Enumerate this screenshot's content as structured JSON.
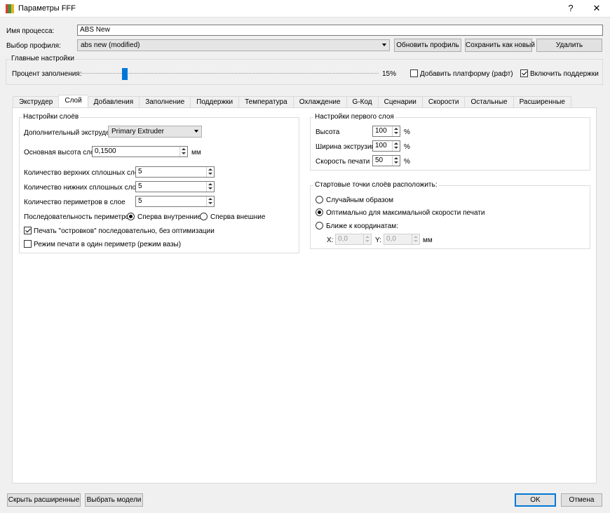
{
  "window": {
    "title": "Параметры FFF",
    "help_glyph": "?",
    "close_glyph": "✕",
    "icon": "app-icon",
    "icon_colors": [
      "#d94135",
      "#2f9e44",
      "#e8b320"
    ]
  },
  "process": {
    "name_label": "Имя процесса:",
    "name_value": "ABS New",
    "profile_label": "Выбор профиля:",
    "profile_value": "abs new (modified)",
    "update_button": "Обновить профиль",
    "save_as_new_button": "Сохранить как новый",
    "delete_button": "Удалить"
  },
  "main_settings": {
    "title": "Главные настройки",
    "infill_label": "Процент заполнения:",
    "infill_value": "15%",
    "infill_fraction": 0.15,
    "raft_label": "Добавить платформу (рафт)",
    "raft_checked": false,
    "supports_label": "Включить поддержки",
    "supports_checked": true
  },
  "tabs": [
    {
      "label": "Экструдер",
      "active": false
    },
    {
      "label": "Слой",
      "active": true
    },
    {
      "label": "Добавления",
      "active": false
    },
    {
      "label": "Заполнение",
      "active": false
    },
    {
      "label": "Поддержки",
      "active": false
    },
    {
      "label": "Температура",
      "active": false
    },
    {
      "label": "Охлаждение",
      "active": false
    },
    {
      "label": "G-Код",
      "active": false
    },
    {
      "label": "Сценарии",
      "active": false
    },
    {
      "label": "Скорости",
      "active": false
    },
    {
      "label": "Остальные",
      "active": false
    },
    {
      "label": "Расширенные",
      "active": false
    }
  ],
  "layer_settings": {
    "title": "Настройки слоёв",
    "extruder_label": "Дополнительный экструдер",
    "extruder_value": "Primary Extruder",
    "layer_height_label": "Основная высота слоя",
    "layer_height_value": "0,1500",
    "layer_height_unit": "мм",
    "top_layers_label": "Количество верхних сплошных слоёв",
    "top_layers_value": "5",
    "bottom_layers_label": "Количество нижних сплошных слоев",
    "bottom_layers_value": "5",
    "perimeters_label": "Количество периметров в слое",
    "perimeters_value": "5",
    "perimeter_order_label": "Последовательность периметров:",
    "inner_first_label": "Сперва внутренние",
    "inner_first_checked": true,
    "outer_first_label": "Сперва внешние",
    "outer_first_checked": false,
    "islands_label": "Печать \"островков\" последовательно, без оптимизации",
    "islands_checked": true,
    "vase_label": "Режим печати в один периметр (режим вазы)",
    "vase_checked": false
  },
  "first_layer": {
    "title": "Настройки первого слоя",
    "height_label": "Высота",
    "height_value": "100",
    "width_label": "Ширина экструзии",
    "width_value": "100",
    "speed_label": "Скорость печати",
    "speed_value": "50",
    "unit": "%"
  },
  "start_points": {
    "title": "Стартовые точки слоёв расположить:",
    "random_label": "Случайным образом",
    "random_checked": false,
    "optimal_label": "Оптимально для максимальной скорости печати",
    "optimal_checked": true,
    "near_label": "Ближе к координатам:",
    "near_checked": false,
    "x_label": "X:",
    "x_value": "0,0",
    "y_label": "Y:",
    "y_value": "0,0",
    "unit": "мм"
  },
  "footer": {
    "hide_advanced_button": "Скрыть расширенные",
    "select_models_button": "Выбрать модели",
    "ok_button": "OK",
    "cancel_button": "Отмена"
  }
}
